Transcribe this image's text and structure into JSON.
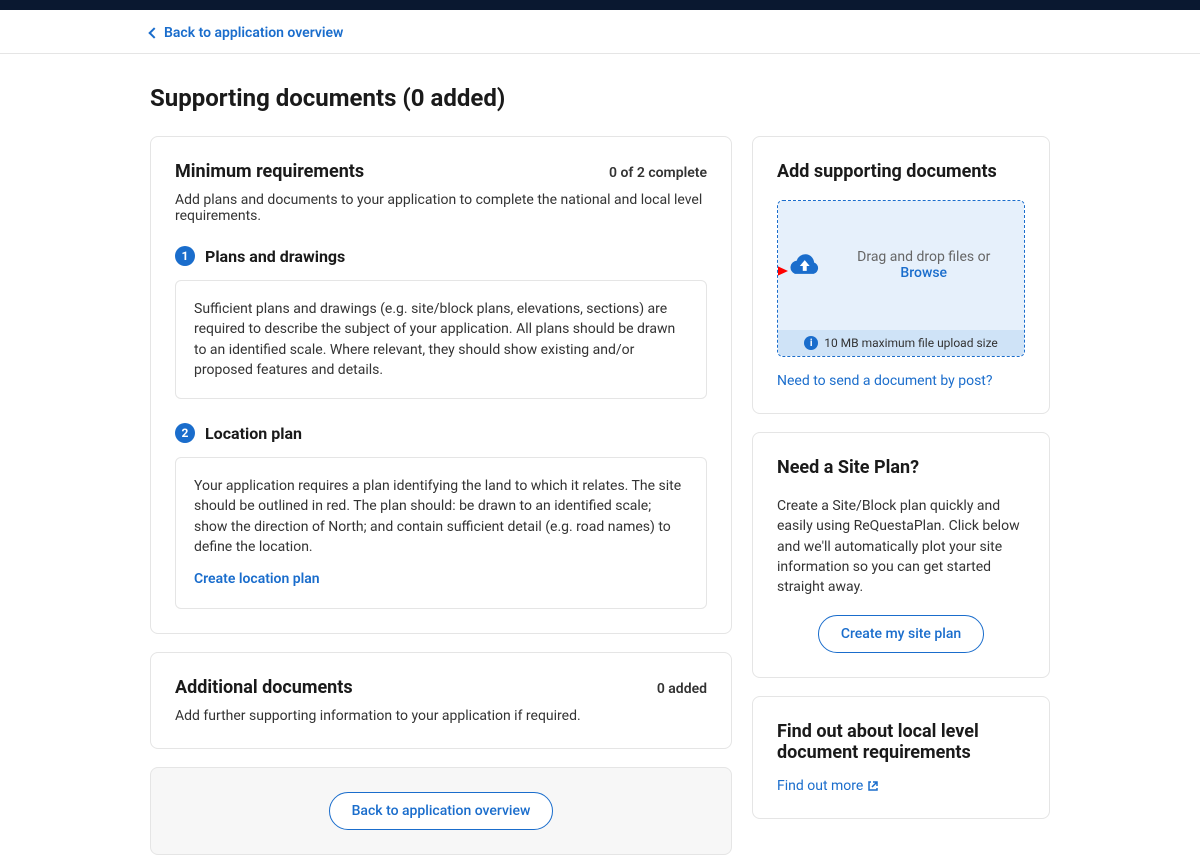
{
  "breadcrumb": {
    "back_label": "Back to application overview"
  },
  "page": {
    "title": "Supporting documents (0 added)"
  },
  "requirements": {
    "title": "Minimum requirements",
    "status": "0 of 2 complete",
    "subtitle": "Add plans and documents to your application to complete the national and local level requirements.",
    "items": [
      {
        "num": "1",
        "title": "Plans and drawings",
        "body": "Sufficient plans and drawings (e.g. site/block plans, elevations, sections) are required to describe the subject of your application. All plans should be drawn to an identified scale. Where relevant, they should show existing and/or proposed features and details."
      },
      {
        "num": "2",
        "title": "Location plan",
        "body": "Your application requires a plan identifying the land to which it relates. The site should be outlined in red. The plan should: be drawn to an identified scale; show the direction of North; and contain sufficient detail (e.g. road names) to define the location.",
        "action_label": "Create location plan"
      }
    ]
  },
  "additional": {
    "title": "Additional documents",
    "status": "0 added",
    "subtitle": "Add further supporting information to your application if required."
  },
  "footer_action": {
    "back_label": "Back to application overview"
  },
  "upload": {
    "title": "Add supporting documents",
    "drop_text": "Drag and drop files or ",
    "browse_label": "Browse",
    "max_size_text": "10 MB maximum file upload size",
    "post_link": "Need to send a document by post?"
  },
  "siteplan": {
    "title": "Need a Site Plan?",
    "body": "Create a Site/Block plan quickly and easily using ReQuestaPlan. Click below and we'll automatically plot your site information so you can get started straight away.",
    "button_label": "Create my site plan"
  },
  "local_req": {
    "title": "Find out about local level document requirements",
    "link_label": "Find out more"
  }
}
